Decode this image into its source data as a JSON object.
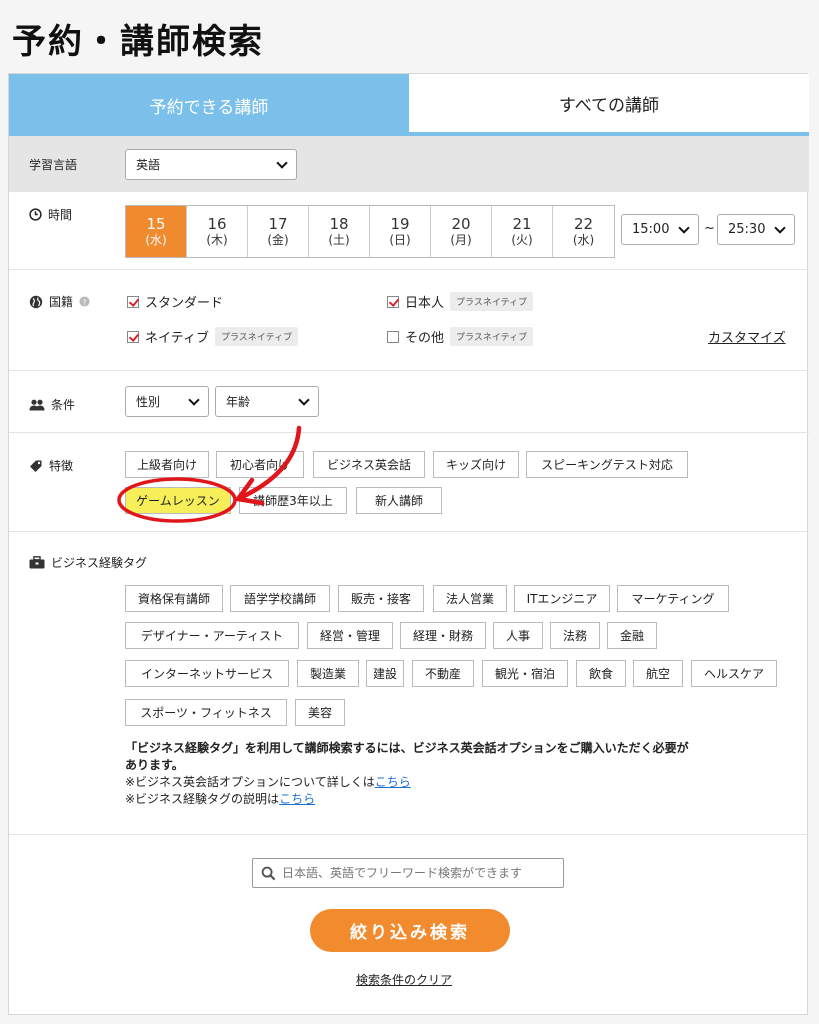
{
  "page_title": "予約・講師検索",
  "tabs": [
    {
      "label": "予約できる講師",
      "active": true
    },
    {
      "label": "すべての講師",
      "active": false
    }
  ],
  "language": {
    "label": "学習言語",
    "selected": "英語"
  },
  "time": {
    "label": "時間",
    "dates": [
      {
        "day": "15",
        "dow": "(水)",
        "selected": true
      },
      {
        "day": "16",
        "dow": "(木)",
        "selected": false
      },
      {
        "day": "17",
        "dow": "(金)",
        "selected": false
      },
      {
        "day": "18",
        "dow": "(土)",
        "selected": false
      },
      {
        "day": "19",
        "dow": "(日)",
        "selected": false
      },
      {
        "day": "20",
        "dow": "(月)",
        "selected": false
      },
      {
        "day": "21",
        "dow": "(火)",
        "selected": false
      },
      {
        "day": "22",
        "dow": "(水)",
        "selected": false
      }
    ],
    "start": "15:00",
    "separator": "~",
    "end": "25:30"
  },
  "nationality": {
    "label": "国籍",
    "options": [
      {
        "label": "スタンダード",
        "checked": true,
        "badge": ""
      },
      {
        "label": "日本人",
        "checked": true,
        "badge": "プラスネイティブ"
      },
      {
        "label": "ネイティブ",
        "checked": true,
        "badge": "プラスネイティブ"
      },
      {
        "label": "その他",
        "checked": false,
        "badge": "プラスネイティブ"
      }
    ],
    "customize": "カスタマイズ"
  },
  "conditions": {
    "label": "条件",
    "gender": "性別",
    "age": "年齢"
  },
  "features": {
    "label": "特徴",
    "items": [
      "上級者向け",
      "初心者向け",
      "ビジネス英会話",
      "キッズ向け",
      "スピーキングテスト対応",
      "ゲームレッスン",
      "講師歴3年以上",
      "新人講師"
    ],
    "highlighted": "ゲームレッスン"
  },
  "business_tags": {
    "label": "ビジネス経験タグ",
    "items": [
      "資格保有講師",
      "語学学校講師",
      "販売・接客",
      "法人営業",
      "ITエンジニア",
      "マーケティング",
      "デザイナー・アーティスト",
      "経営・管理",
      "経理・財務",
      "人事",
      "法務",
      "金融",
      "インターネットサービス",
      "製造業",
      "建設",
      "不動産",
      "観光・宿泊",
      "飲食",
      "航空",
      "ヘルスケア",
      "スポーツ・フィットネス",
      "美容"
    ],
    "note_bold_1": "「ビジネス経験タグ」を利用して講師検索するには、ビジネス英会話オプションをご購入いただく必要が",
    "note_bold_2": "あります。",
    "note_line1_prefix": "※ビジネス英会話オプションについて詳しくは",
    "note_line2_prefix": "※ビジネス経験タグの説明は",
    "link_text": "こちら"
  },
  "search": {
    "placeholder": "日本語、英語でフリーワード検索ができます"
  },
  "filter_button": "絞り込み検索",
  "clear_link": "検索条件のクリア",
  "colors": {
    "tab_active": "#7ac0ea",
    "accent_orange": "#f28a2e",
    "highlight_yellow": "#f6ef5a",
    "annotation_red": "#e0161c"
  }
}
